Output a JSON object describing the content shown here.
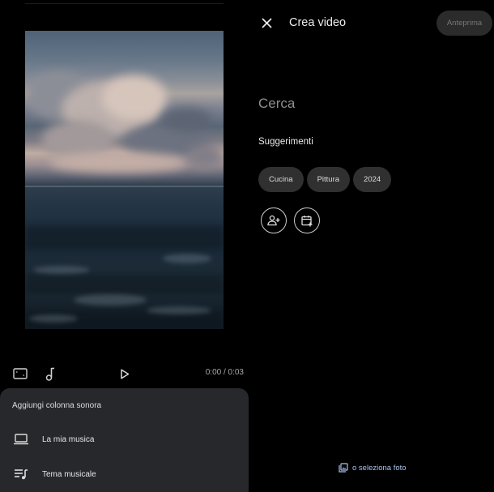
{
  "editor": {
    "time_display": "0:00 / 0:03",
    "icons": {
      "aspect": "aspect-ratio-icon",
      "music": "music-note-icon",
      "play": "play-icon"
    }
  },
  "soundtrack_sheet": {
    "title": "Aggiungi colonna sonora",
    "items": [
      {
        "label": "La mia musica",
        "icon": "laptop-icon"
      },
      {
        "label": "Tema musicale",
        "icon": "queue-music-icon"
      }
    ]
  },
  "panel": {
    "title": "Crea video",
    "preview_label": "Anteprima",
    "search_placeholder": "Cerca",
    "suggestions_label": "Suggerimenti",
    "chips": [
      "Cucina",
      "Pittura",
      "2024"
    ],
    "select_photos_label": "o seleziona foto"
  },
  "colors": {
    "background": "#000000",
    "sheet": "#26282b",
    "chip": "#303030",
    "link": "#a9c3ee"
  }
}
